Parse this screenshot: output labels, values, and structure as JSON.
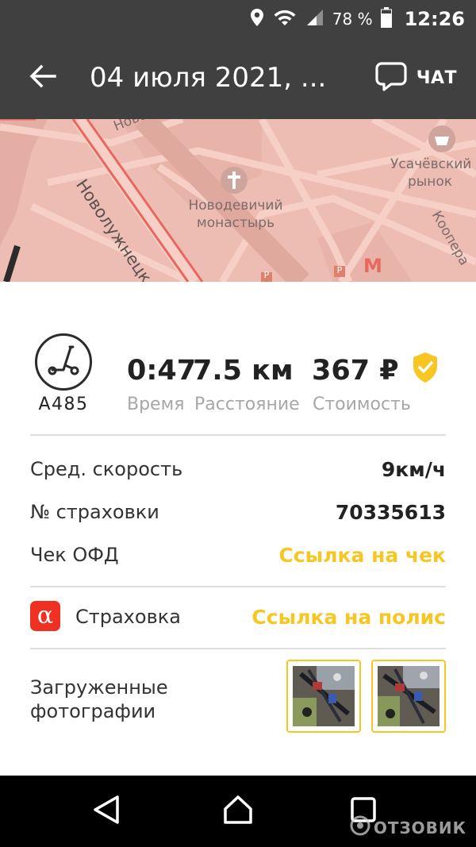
{
  "status_bar": {
    "battery_percent": "78 %",
    "time": "12:26",
    "icons": [
      "location-icon",
      "wifi-icon",
      "signal-icon",
      "battery-icon"
    ]
  },
  "app_bar": {
    "title": "04 июля 2021, ...",
    "chat_label": "ЧАТ",
    "icons": [
      "back-arrow-icon",
      "chat-bubble-icon"
    ]
  },
  "map": {
    "labels": {
      "street_top": "Новод",
      "street_main": "Новолужнецк",
      "monastery": "Новодевичий монастырь",
      "market": "Усачёвский рынок",
      "street_right": "Коопера",
      "parking": "P",
      "metro": "M"
    },
    "colors": {
      "land": "#edbcb2",
      "road": "#f6cfc6",
      "main_road": "#e8675f",
      "label": "#7c6c6c"
    }
  },
  "trip": {
    "scooter_id": "A485",
    "stats": [
      {
        "value": "0:47",
        "label": "Время"
      },
      {
        "value": "7.5 км",
        "label": "Расстояние"
      },
      {
        "value": "367 ₽",
        "label": "Стоимость"
      }
    ],
    "avg_speed_label": "Сред. скорость",
    "avg_speed_value": "9км/ч",
    "insurance_no_label": "№ страховки",
    "insurance_no_value": "70335613",
    "receipt_label": "Чек ОФД",
    "receipt_link": "Ссылка на чек",
    "insurance_label": "Страховка",
    "insurance_logo": "α",
    "insurance_link": "Ссылка на полис",
    "photos_label_line1": "Загруженные",
    "photos_label_line2": "фотографии",
    "photos_count": 2
  },
  "nav_bar": {
    "buttons": [
      "back-triangle-icon",
      "home-icon",
      "recents-icon"
    ],
    "watermark": "ОТЗОВИК"
  },
  "colors": {
    "bar_dark": "#404040",
    "accent_yellow": "#f8c623",
    "alfa_red": "#ef3124",
    "muted_text": "#a7a7a7"
  }
}
